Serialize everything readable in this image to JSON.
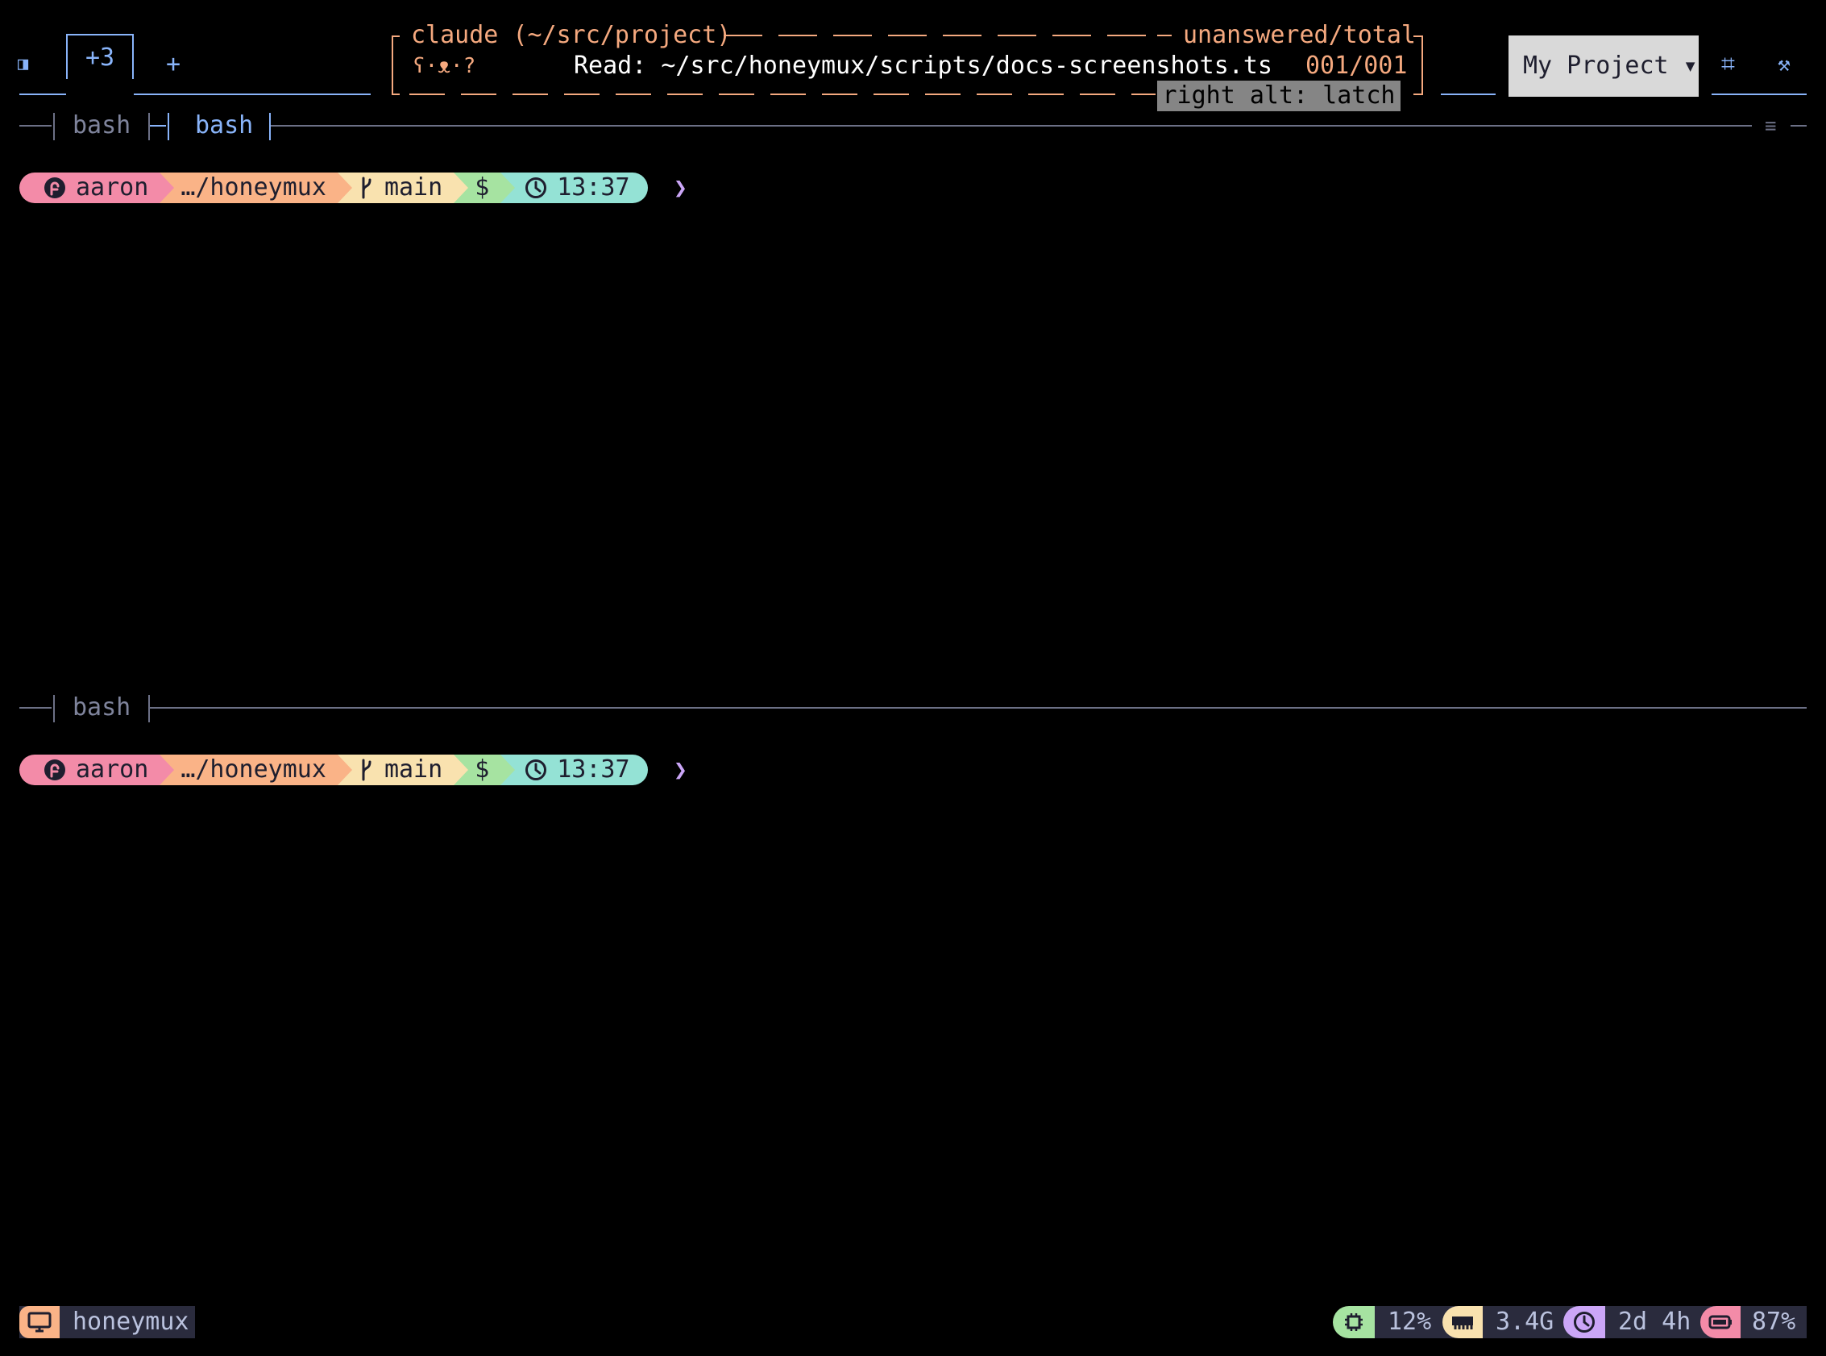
{
  "topbar": {
    "tab_overflow_label": "+3",
    "new_tab_label": "+",
    "project_label": "My Project ▾",
    "grid_icon": "⌗",
    "tools_icon": "⚒"
  },
  "notification": {
    "title": "claude (~/src/project)",
    "counter_header": "unanswered/total",
    "status_glyph": "ʕ·ᴥ·?",
    "message": "Read: ~/src/honeymux/scripts/docs-screenshots.ts",
    "counter": "001/001",
    "latch_hint": "right alt: latch"
  },
  "panes": [
    {
      "tabs": [
        "bash",
        "bash"
      ],
      "active_tab": 1,
      "menu_icon": "≡",
      "prompt": {
        "user": "aaron",
        "dir": "…/honeymux",
        "branch": "main",
        "shell": "$",
        "time": "13:37",
        "caret": "❯"
      }
    },
    {
      "tabs": [
        "bash"
      ],
      "prompt": {
        "user": "aaron",
        "dir": "…/honeymux",
        "branch": "main",
        "shell": "$",
        "time": "13:37",
        "caret": "❯"
      }
    }
  ],
  "statusbar": {
    "session": "honeymux",
    "cpu": "12%",
    "mem": "3.4G",
    "uptime": "2d 4h",
    "battery": "87%"
  },
  "colors": {
    "accent": "#89b4fa",
    "notification": "#f5a97f",
    "user_seg": "#f38ba8",
    "dir_seg": "#fab387",
    "git_seg": "#f9e2af",
    "shell_seg": "#a6e3a1",
    "time_seg": "#94e2d5",
    "caret": "#cba6f7"
  },
  "icons": {
    "sidebar": "sidebar-toggle-icon",
    "user": "fedora-icon",
    "branch": "git-branch-icon",
    "time": "clock-icon",
    "session": "monitor-icon",
    "cpu": "cpu-chip-icon",
    "mem": "memory-icon",
    "uptime": "clock-icon",
    "battery": "battery-icon"
  }
}
